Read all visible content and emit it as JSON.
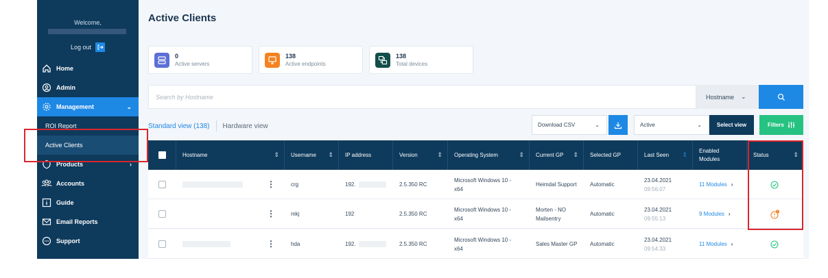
{
  "sidebar": {
    "welcome": "Welcome,",
    "logout": "Log out",
    "items": [
      {
        "label": "Home",
        "icon": "home-icon"
      },
      {
        "label": "Admin",
        "icon": "admin-icon"
      },
      {
        "label": "Management",
        "icon": "gear-icon"
      },
      {
        "label": "ROI Report"
      },
      {
        "label": "Active Clients"
      },
      {
        "label": "Products",
        "icon": "shield-icon"
      },
      {
        "label": "Accounts",
        "icon": "users-icon"
      },
      {
        "label": "Guide",
        "icon": "info-icon"
      },
      {
        "label": "Email Reports",
        "icon": "mail-icon"
      },
      {
        "label": "Support",
        "icon": "chat-icon"
      }
    ]
  },
  "page": {
    "title": "Active Clients"
  },
  "stats": [
    {
      "count": "0",
      "label": "Active servers",
      "color": "#5b6fd6"
    },
    {
      "count": "138",
      "label": "Active endpoints",
      "color": "#f58220"
    },
    {
      "count": "138",
      "label": "Total devices",
      "color": "#134e4a"
    }
  ],
  "search": {
    "placeholder": "Search by Hostname",
    "field": "Hostname"
  },
  "views": {
    "standard": "Standard view (138)",
    "hardware": "Hardware view"
  },
  "toolbar": {
    "download": "Download CSV",
    "active": "Active",
    "select_view": "Select view",
    "filters": "Filters"
  },
  "table": {
    "headers": [
      "Hostname",
      "Username",
      "IP address",
      "Version",
      "Operating System",
      "Current GP",
      "Selected GP",
      "Last Seen",
      "Enabled Modules",
      "Status"
    ],
    "rows": [
      {
        "username": "crg",
        "ip": "192.",
        "version": "2.5.350 RC",
        "os": "Microsoft Windows 10 - x64",
        "current_gp": "Heimdal Support",
        "selected_gp": "Automatic",
        "date": "23.04.2021",
        "time": "09:56:07",
        "modules": "11 Modules",
        "status": "ok"
      },
      {
        "username": "mkj",
        "ip": "192",
        "version": "2.5.350 RC",
        "os": "Microsoft Windows 10 - x64",
        "current_gp": "Morten - NO Mailsentry",
        "selected_gp": "Automatic",
        "date": "23.04.2021",
        "time": "09:55:13",
        "modules": "9 Modules",
        "status": "warning"
      },
      {
        "username": "hda",
        "ip": "192.",
        "version": "2.5.350 RC",
        "os": "Microsoft Windows 10 - x64",
        "current_gp": "Sales Master GP",
        "selected_gp": "Automatic",
        "date": "23.04.2021",
        "time": "09:54:33",
        "modules": "11 Modules",
        "status": "ok"
      }
    ]
  },
  "colors": {
    "sidebar": "#0e3a5c",
    "accent": "#1e88e5",
    "green": "#26c281",
    "orange": "#f58220",
    "highlight": "#d9252b"
  }
}
